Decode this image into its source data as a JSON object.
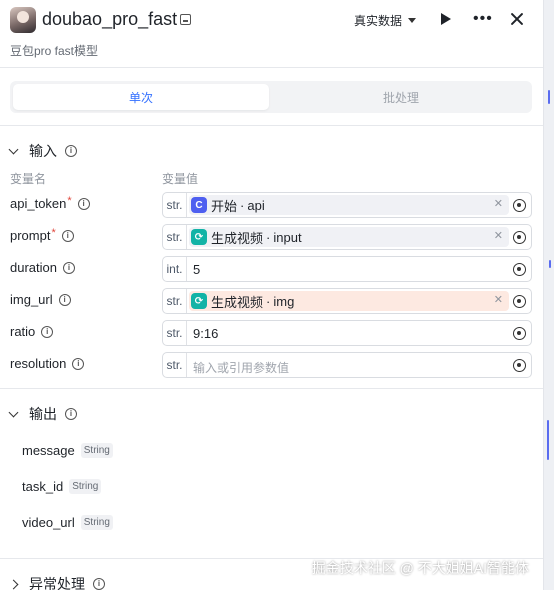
{
  "header": {
    "title": "doubao_pro_fast",
    "subtitle": "豆包pro fast模型",
    "data_select": "真实数据"
  },
  "tabs": [
    {
      "label": "单次",
      "active": true
    },
    {
      "label": "批处理",
      "active": false
    }
  ],
  "input_section": {
    "title": "输入",
    "col_name": "变量名",
    "col_value": "变量值",
    "params": [
      {
        "name": "api_token",
        "required": "*",
        "type": "str.",
        "ref_node": "开始",
        "ref_var": "api"
      },
      {
        "name": "prompt",
        "required": "*",
        "type": "str.",
        "ref_node": "生成视频",
        "ref_var": "input"
      },
      {
        "name": "duration",
        "type": "int.",
        "value": "5"
      },
      {
        "name": "img_url",
        "type": "str.",
        "ref_node": "生成视频",
        "ref_var": "img"
      },
      {
        "name": "ratio",
        "type": "str.",
        "value": "9:16"
      },
      {
        "name": "resolution",
        "type": "str.",
        "placeholder": "输入或引用参数值"
      }
    ]
  },
  "output_section": {
    "title": "输出",
    "items": [
      {
        "name": "message",
        "type": "String"
      },
      {
        "name": "task_id",
        "type": "String"
      },
      {
        "name": "video_url",
        "type": "String"
      }
    ]
  },
  "exception_section": {
    "title": "异常处理"
  },
  "separator": "·",
  "watermark": "掘金技术社区 @ 不大姐姐AI智能体",
  "colors": {
    "accent": "#3370ff",
    "start_node": "#4e5ff0",
    "gen_node": "#12b3a6",
    "warn_bg": "#fde9e1"
  }
}
